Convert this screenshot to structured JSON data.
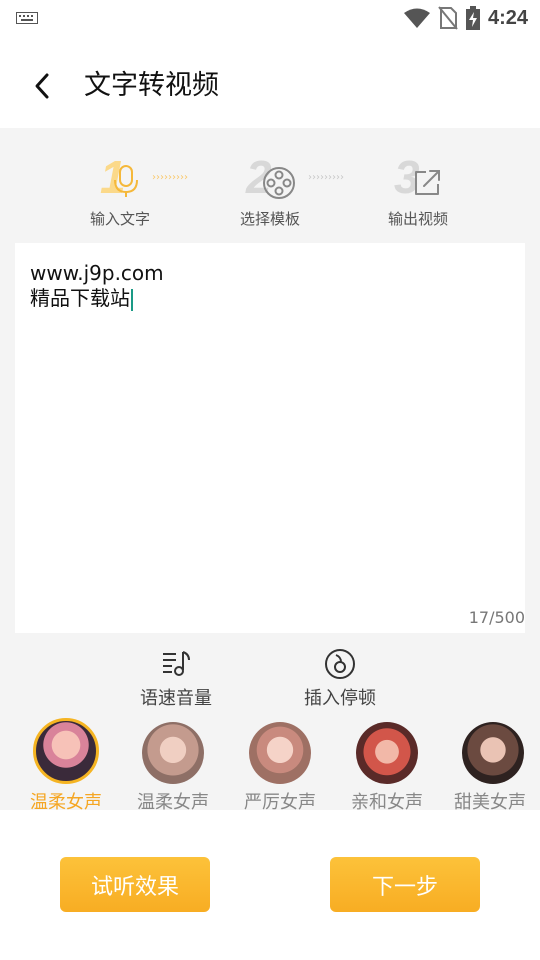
{
  "status": {
    "time": "4:24"
  },
  "header": {
    "title": "文字转视频"
  },
  "steps": [
    {
      "number": "1",
      "label": "输入文字",
      "icon": "microphone-icon"
    },
    {
      "number": "2",
      "label": "选择模板",
      "icon": "film-reel-icon"
    },
    {
      "number": "3",
      "label": "输出视频",
      "icon": "share-icon"
    }
  ],
  "arrows": "›››››››››",
  "editor": {
    "lines": [
      "www.j9p.com",
      "精品下载站"
    ],
    "counter": "17/500"
  },
  "tools": [
    {
      "label": "语速音量",
      "icon": "music-speed-icon"
    },
    {
      "label": "插入停顿",
      "icon": "pause-insert-icon"
    }
  ],
  "voices": [
    {
      "label": "温柔女声",
      "selected": true
    },
    {
      "label": "温柔女声",
      "selected": false
    },
    {
      "label": "严厉女声",
      "selected": false
    },
    {
      "label": "亲和女声",
      "selected": false
    },
    {
      "label": "甜美女声",
      "selected": false
    }
  ],
  "buttons": {
    "preview": "试听效果",
    "next": "下一步"
  },
  "colors": {
    "accent": "#f8ad23",
    "active_text": "#f5a623",
    "background": "#f4f4f4"
  }
}
